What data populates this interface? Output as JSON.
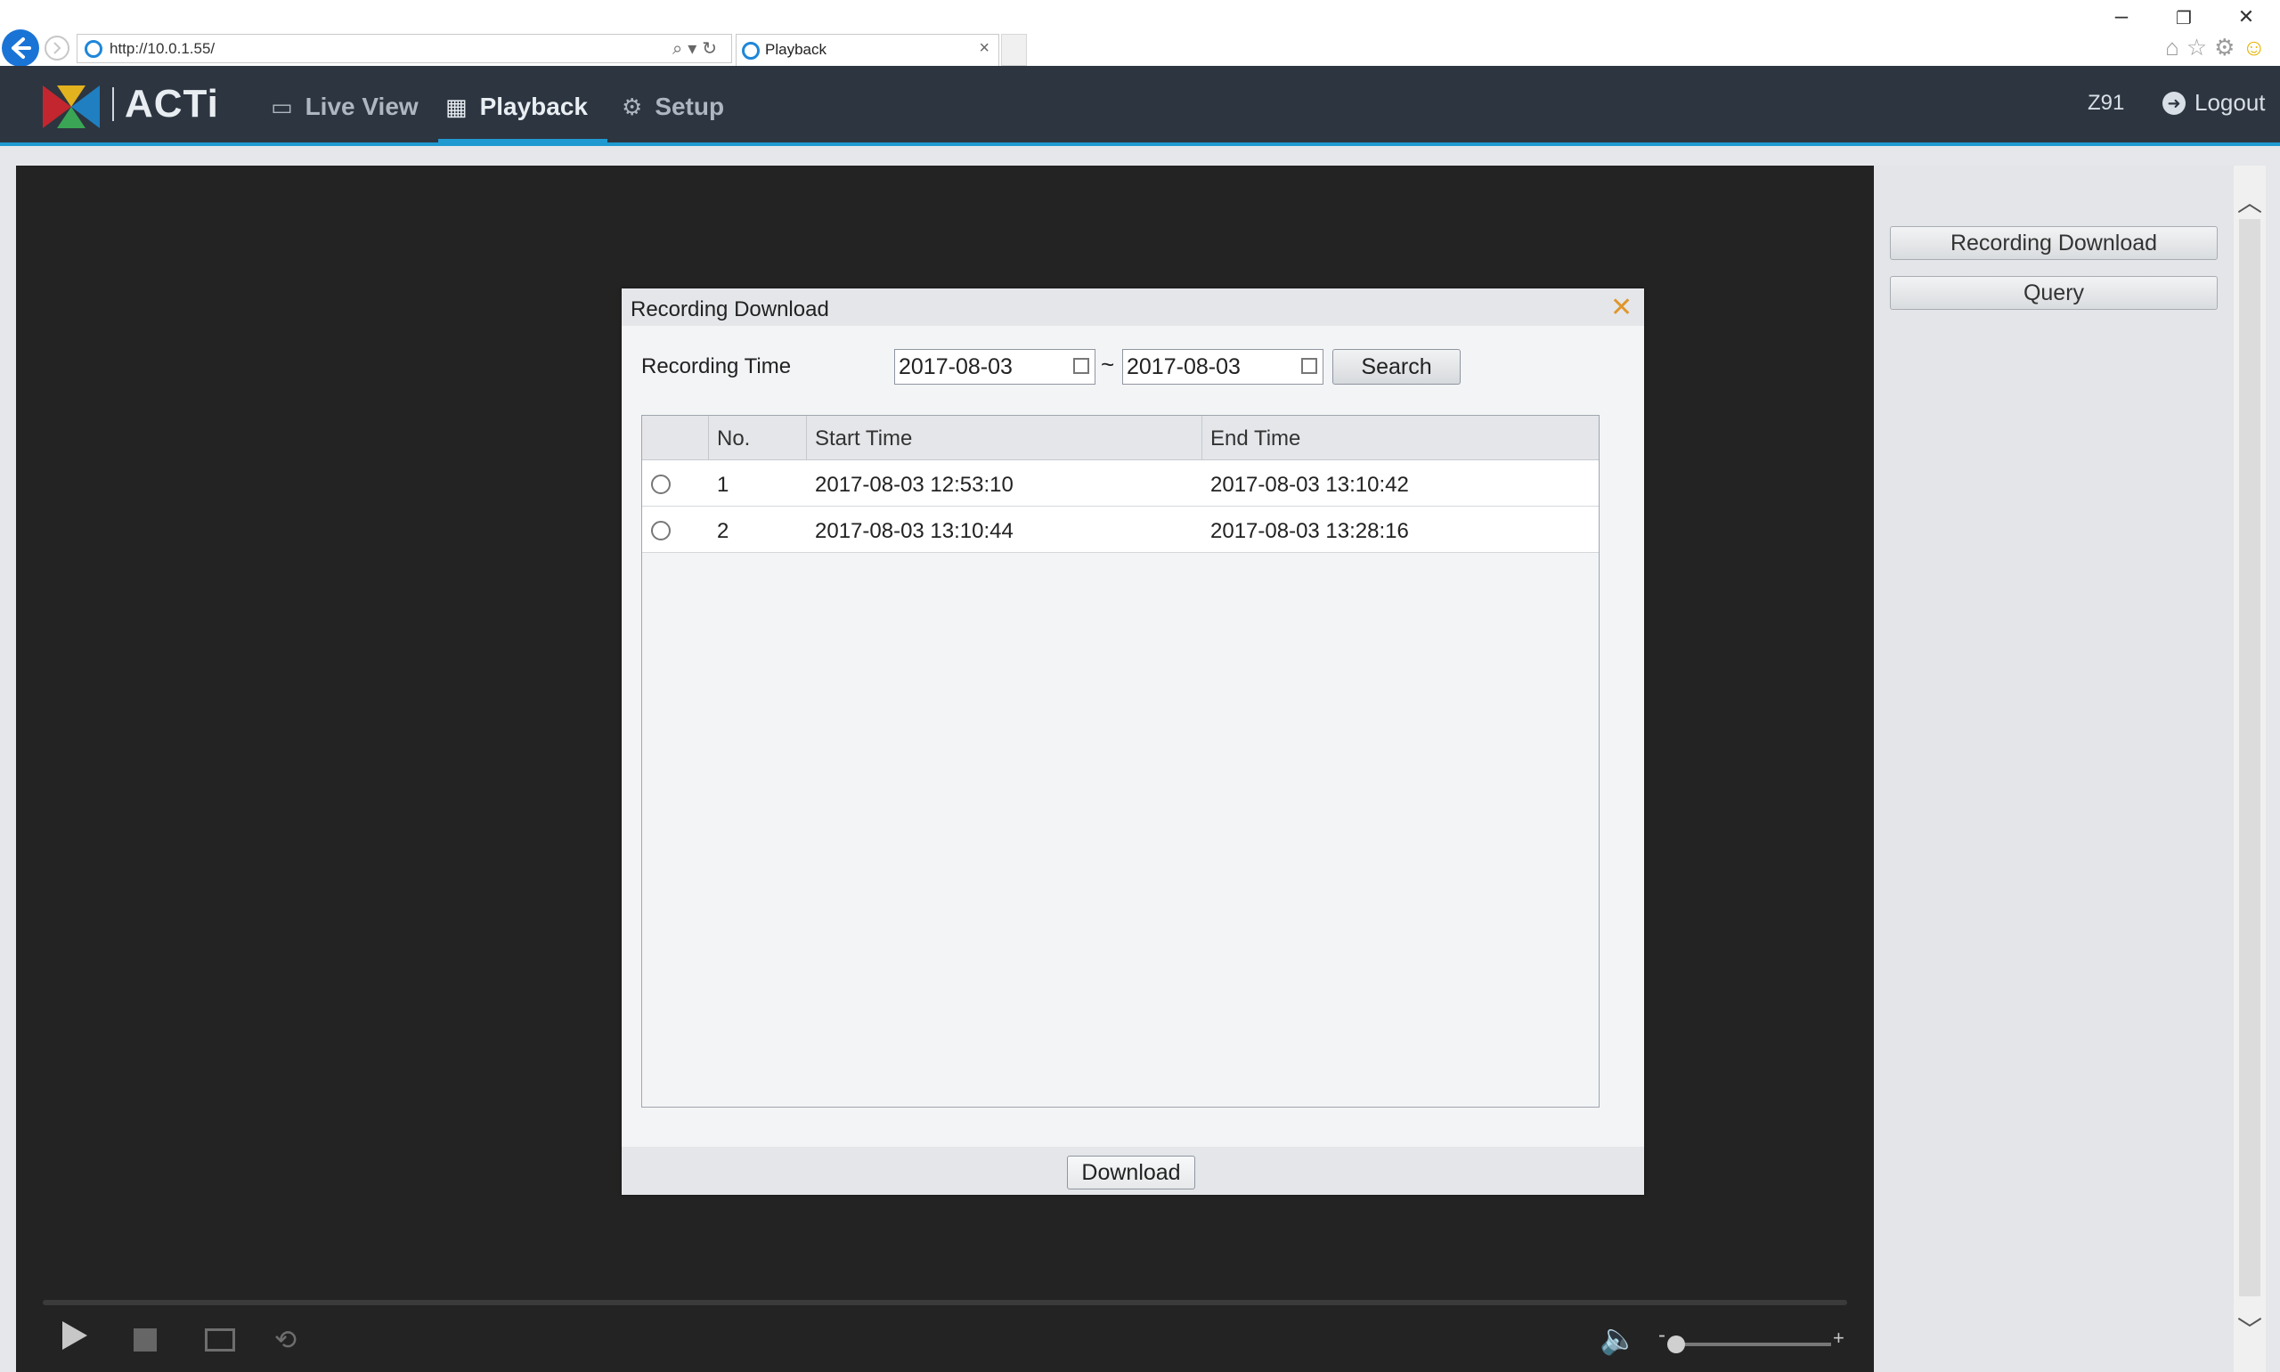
{
  "browser": {
    "address": "http://10.0.1.55/",
    "tab_title": "Playback",
    "tab_close": "×",
    "window_controls": [
      "–",
      "❐",
      "✕"
    ]
  },
  "app": {
    "brand": "ACTi",
    "nav": {
      "live_view": "Live View",
      "playback": "Playback",
      "setup": "Setup"
    },
    "user": "Z91",
    "logout": "Logout"
  },
  "side_panel": {
    "recording_download": "Recording Download",
    "query": "Query"
  },
  "dialog": {
    "title": "Recording Download",
    "recording_time_label": "Recording Time",
    "start_date": "2017-08-03",
    "separator": "~",
    "end_date": "2017-08-03",
    "search_button": "Search",
    "columns": {
      "no": "No.",
      "start": "Start Time",
      "end": "End Time"
    },
    "rows": [
      {
        "no": "1",
        "start": "2017-08-03 12:53:10",
        "end": "2017-08-03 13:10:42"
      },
      {
        "no": "2",
        "start": "2017-08-03 13:10:44",
        "end": "2017-08-03 13:28:16"
      }
    ],
    "download_button": "Download"
  },
  "player": {
    "volume_minus": "-",
    "volume_plus": "+"
  },
  "colors": {
    "navbar": "#2d3540",
    "accent": "#1f9ad1",
    "video_bg": "#232323",
    "close_icon": "#e0962c"
  }
}
